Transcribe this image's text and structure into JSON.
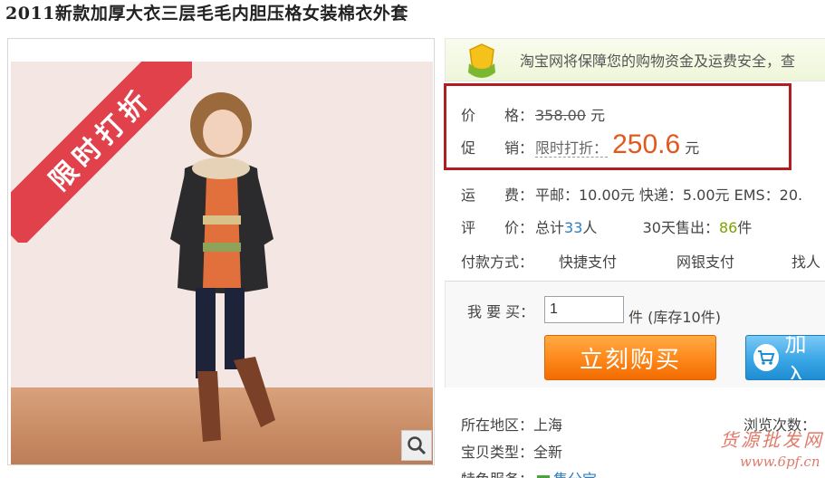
{
  "title": "2011新款加厚大衣三层毛毛内胆压格女装棉衣外套",
  "image": {
    "banner": "限时打折",
    "zoom_icon": "magnifier-icon"
  },
  "guarantee": {
    "icon": "shield-hands-icon",
    "text": "淘宝网将保障您的购物资金及运费安全，查"
  },
  "price": {
    "label": "价　　格：",
    "original": "358.00",
    "unit": "元"
  },
  "promo": {
    "label": "促　　销：",
    "tag": "限时打折：",
    "price": "250.6",
    "unit": "元"
  },
  "shipping": {
    "label": "运　　费：",
    "value": "平邮：10.00元 快递：5.00元 EMS：20."
  },
  "review": {
    "label": "评　　价：",
    "total_prefix": "总计",
    "total_count": "33",
    "total_suffix": "人",
    "sold_prefix": "30天售出：",
    "sold_count": "86",
    "sold_suffix": "件"
  },
  "payment": {
    "label": "付款方式：",
    "options": [
      "快捷支付",
      "网银支付",
      "找人"
    ]
  },
  "buy": {
    "label": "我 要 买：",
    "quantity": "1",
    "stock": "件 (库存10件)",
    "buy_now": "立刻购买",
    "add_cart": "加入"
  },
  "details": {
    "location_label": "所在地区：",
    "location": "上海",
    "type_label": "宝贝类型：",
    "type": "全新",
    "service_label": "特色服务：",
    "service": "集分宝",
    "views_label": "浏览次数："
  },
  "watermark": {
    "line1": "货源批发网",
    "line2": "www.6pf.cn"
  },
  "colors": {
    "price_red": "#e4571c",
    "border_red": "#b01d22",
    "buy_orange": "#ff8a1d",
    "cart_blue": "#3aa6e6"
  }
}
